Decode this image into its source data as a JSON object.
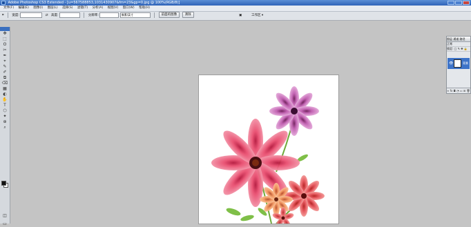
{
  "window": {
    "title": "Adobe Photoshop CS3 Extended - [u=567588853,1031430907&fm=23&gp=0.jpg @ 100%(RGB/8)]"
  },
  "menu": {
    "items": [
      "文件(F)",
      "编辑(E)",
      "图像(I)",
      "图层(L)",
      "选择(S)",
      "滤镜(T)",
      "分析(A)",
      "视图(V)",
      "窗口(W)",
      "帮助(H)"
    ]
  },
  "options": {
    "width_label": "宽度:",
    "height_label": "高度:",
    "resolution_label": "分辨率:",
    "unit_value": "像素/英寸",
    "front_image_button": "前面的图像",
    "clear_button": "清除",
    "workspace_label": "工作区 ▾"
  },
  "tools": [
    "✥",
    "⬚",
    "ʘ",
    "✂",
    "✒",
    "⌖",
    "✎",
    "✐",
    "⧉",
    "⌫",
    "▦",
    "◐",
    "✋",
    "T",
    "⬡",
    "✦",
    "⊕",
    "⌕"
  ],
  "colors": {
    "foreground": "#111111",
    "background": "#ffffff",
    "accent": "#3d73c8"
  },
  "layers_panel": {
    "tabs": "图层  通道  路径",
    "mode_row": "正常",
    "lock_row": "锁定: □ ✎ ✥ 🔒",
    "layer_name": "背景",
    "eye_icon": "👁",
    "footer": "∞ fx ◘ ◔ ▭ ⊞ 🗑"
  }
}
